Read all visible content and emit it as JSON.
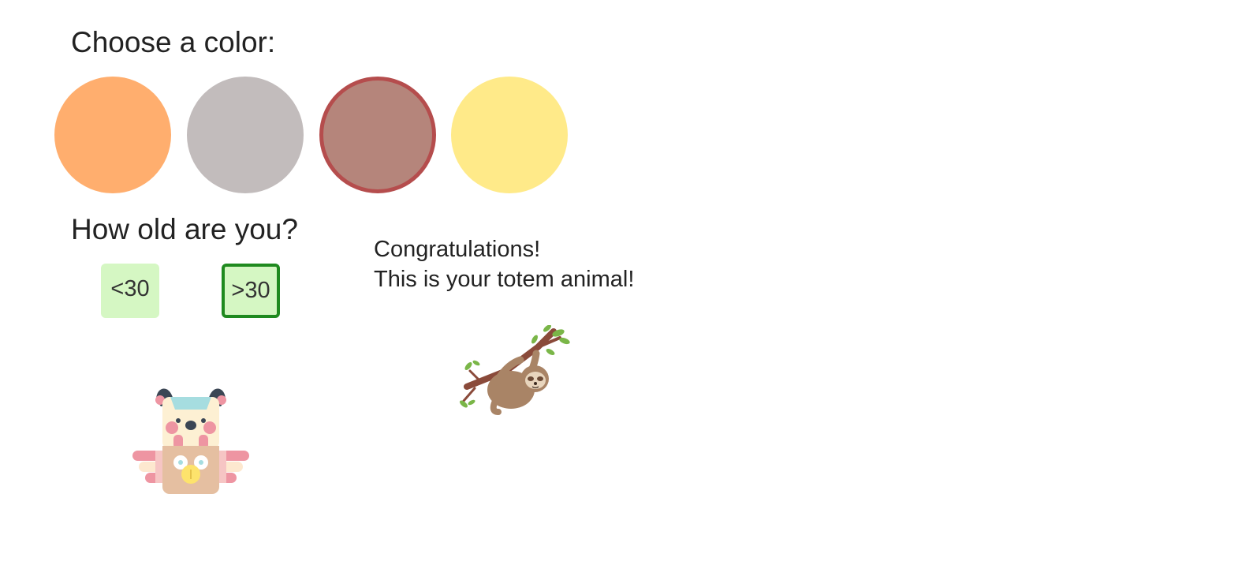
{
  "color_section": {
    "heading": "Choose a color:",
    "swatches": [
      {
        "color": "#ffae6e",
        "selected": false
      },
      {
        "color": "#c2bcbc",
        "selected": false
      },
      {
        "color": "#b5857b",
        "selected": true
      },
      {
        "color": "#ffea89",
        "selected": false
      }
    ],
    "selected_border_color": "#b54d4d"
  },
  "age_section": {
    "heading": "How old are you?",
    "options": [
      {
        "label": "<30",
        "selected": false
      },
      {
        "label": ">30",
        "selected": true
      }
    ],
    "option_bg_color": "#d5f7c3",
    "selected_border_color": "#1f8a1f"
  },
  "result": {
    "line1": "Congratulations!",
    "line2": "This is your totem animal!"
  },
  "images": {
    "totem": "totem-pole-icon",
    "animal": "sloth-illustration"
  }
}
